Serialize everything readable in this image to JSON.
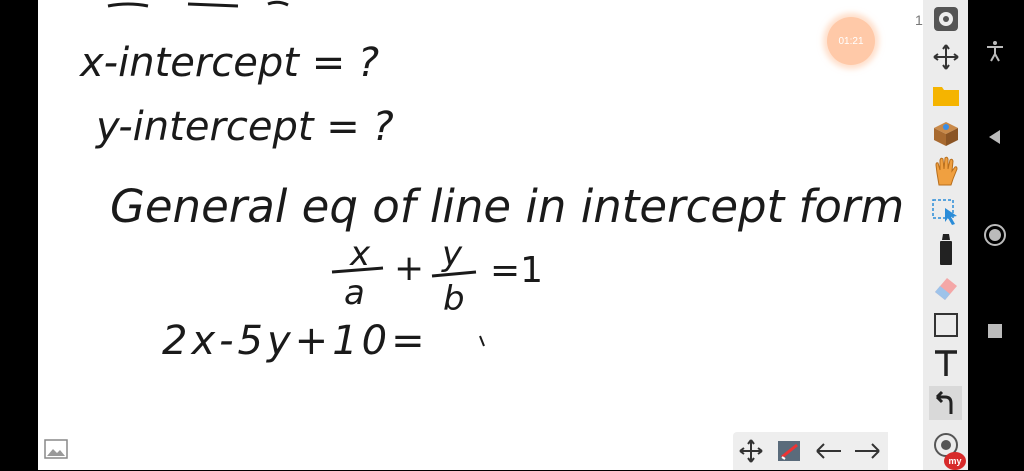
{
  "whiteboard": {
    "lines": [
      "x-intercept = ?",
      "y-intercept = ?",
      "General eq of line in intercept form",
      "x",
      "a",
      "+",
      "y",
      "b",
      "=1",
      "2x-5y+10="
    ]
  },
  "page_counter": "1/",
  "timer": "01:21",
  "badge": "my",
  "icons": {
    "right_toolbar": [
      "settings-icon",
      "move-icon",
      "folder-icon",
      "box-icon",
      "hand-icon",
      "select-icon",
      "marker-icon",
      "eraser-icon",
      "rectangle-icon",
      "text-icon",
      "undo-icon",
      "record-icon"
    ],
    "bottom_toolbar": [
      "move-icon",
      "image-edit-icon",
      "arrow-left-icon",
      "arrow-right-icon"
    ],
    "system": [
      "accessibility-icon",
      "back-icon",
      "home-icon",
      "recents-icon"
    ]
  },
  "colors": {
    "folder": "#f5b400",
    "hand": "#f0a040",
    "select": "#2a8cd8",
    "badge": "#d72a2a"
  }
}
